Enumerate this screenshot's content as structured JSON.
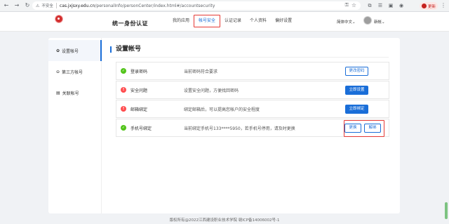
{
  "browser": {
    "security_label": "不安全",
    "url_host": "cas.jxjsxy.edu.cn",
    "url_path": "/personalInfo/personCenter/index.html#/accountsecurity",
    "update_label": "更新"
  },
  "header": {
    "app_title": "统一身份认证",
    "nav": [
      "我的应用",
      "帐号安全",
      "认证记录",
      "个人资料",
      "偏好设置"
    ],
    "active_nav": "帐号安全",
    "language": "简体中文",
    "user_name": "新帐"
  },
  "sidebar": {
    "items": [
      {
        "label": "设置帐号",
        "icon": "gear-icon"
      },
      {
        "label": "第三方帐号",
        "icon": "link-icon"
      },
      {
        "label": "关联帐号",
        "icon": "card-icon"
      }
    ]
  },
  "main": {
    "section_title": "设置帐号",
    "rows": [
      {
        "name": "登录密码",
        "status": "ok",
        "desc": "当前密码符合要求",
        "buttons": [
          {
            "label": "更改密码",
            "style": "outline"
          }
        ]
      },
      {
        "name": "安全问题",
        "status": "warn",
        "desc": "设置安全问题，方便找回密码",
        "buttons": [
          {
            "label": "立即设置",
            "style": "solid"
          }
        ]
      },
      {
        "name": "邮箱绑定",
        "status": "warn",
        "desc": "绑定邮箱后，可以提高您帐户的安全程度",
        "buttons": [
          {
            "label": "立即绑定",
            "style": "solid"
          }
        ]
      },
      {
        "name": "手机号绑定",
        "status": "ok",
        "desc": "当前绑定手机号133****5950，若手机号停用，请及时更换",
        "buttons": [
          {
            "label": "更换",
            "style": "outline"
          },
          {
            "label": "解绑",
            "style": "outline"
          }
        ]
      }
    ]
  },
  "footer": {
    "text": "版权所有@2022江西建设职业技术学院 赣ICP备14006002号-1"
  },
  "colors": {
    "accent": "#1a6ed8",
    "highlight": "#e53935",
    "ok": "#52c41a",
    "warn": "#ff4d4f"
  }
}
